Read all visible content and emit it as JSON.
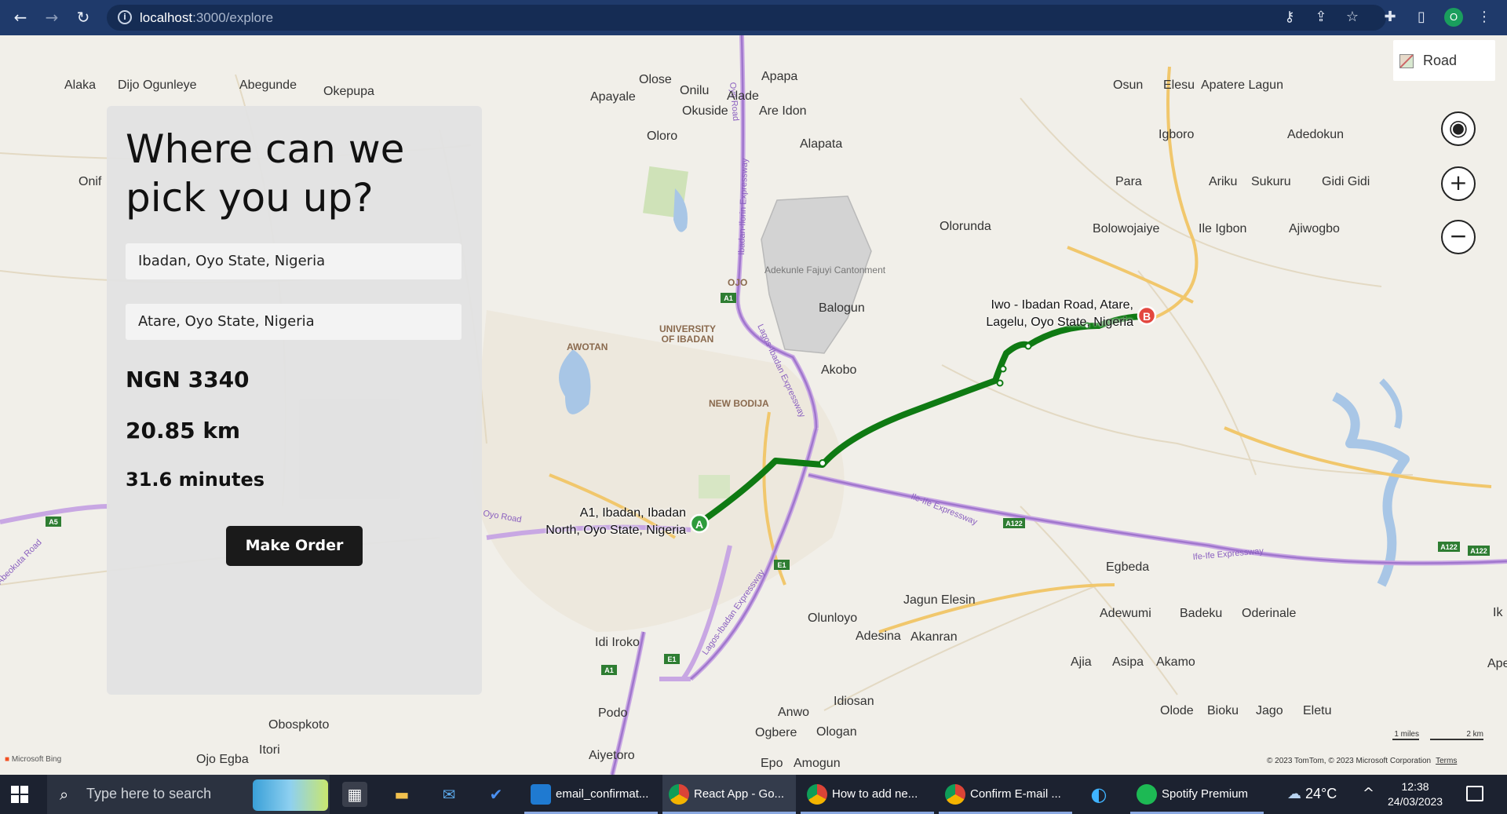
{
  "browser": {
    "url_host": "localhost",
    "url_path": ":3000/explore",
    "profile_initial": "O"
  },
  "map": {
    "type_label": "Road",
    "places": [
      {
        "name": "Alaka"
      },
      {
        "name": "Dijo Ogunleye"
      },
      {
        "name": "Abegunde"
      },
      {
        "name": "Okepupa"
      },
      {
        "name": "Olose"
      },
      {
        "name": "Onilu"
      },
      {
        "name": "Apapa"
      },
      {
        "name": "Apayale"
      },
      {
        "name": "Alade"
      },
      {
        "name": "Okuside"
      },
      {
        "name": "Are Idon"
      },
      {
        "name": "Oloro"
      },
      {
        "name": "Alapata"
      },
      {
        "name": "Osun"
      },
      {
        "name": "Elesu"
      },
      {
        "name": "Apatere Lagun"
      },
      {
        "name": "Igboro"
      },
      {
        "name": "Adedokun"
      },
      {
        "name": "Para"
      },
      {
        "name": "Ariku"
      },
      {
        "name": "Sukuru"
      },
      {
        "name": "Gidi Gidi"
      },
      {
        "name": "Olorunda"
      },
      {
        "name": "Bolowojaiye"
      },
      {
        "name": "Ile Igbon"
      },
      {
        "name": "Ajiwogbo"
      },
      {
        "name": "Balogun"
      },
      {
        "name": "Akobo"
      },
      {
        "name": "Onif"
      },
      {
        "name": "Egbeda"
      },
      {
        "name": "Adewumi"
      },
      {
        "name": "Badeku"
      },
      {
        "name": "Oderinale"
      },
      {
        "name": "Jagun Elesin"
      },
      {
        "name": "Olunloyo"
      },
      {
        "name": "Adesina"
      },
      {
        "name": "Akanran"
      },
      {
        "name": "Ajia"
      },
      {
        "name": "Asipa"
      },
      {
        "name": "Akamo"
      },
      {
        "name": "Idi Iroko"
      },
      {
        "name": "Podo"
      },
      {
        "name": "Anwo"
      },
      {
        "name": "Idiosan"
      },
      {
        "name": "Ogbere"
      },
      {
        "name": "Ologan"
      },
      {
        "name": "Obospkoto"
      },
      {
        "name": "Itori"
      },
      {
        "name": "Ojo Egba"
      },
      {
        "name": "Aiyetoro"
      },
      {
        "name": "Epo"
      },
      {
        "name": "Amogun"
      },
      {
        "name": "Olode"
      },
      {
        "name": "Bioku"
      },
      {
        "name": "Jago"
      },
      {
        "name": "Eletu"
      },
      {
        "name": "Ik"
      },
      {
        "name": "Ape"
      }
    ],
    "district_labels": [
      "Adekunle Fajuyi Cantonment",
      "UNIVERSITY OF IBADAN",
      "AWOTAN",
      "NEW BODIJA",
      "OJO"
    ],
    "road_labels": [
      "Oyo Road",
      "Ibadan-Ilorin Expressway",
      "Lagos-Ibadan Expressway",
      "Ile-Ife Expressway",
      "Ife-Ife Expressway",
      "Abeokuta Road",
      "Oyo Road"
    ],
    "road_shields": [
      "A1",
      "A1",
      "E1",
      "E1",
      "A122",
      "A122",
      "A122",
      "A5"
    ],
    "start_label_line1": "A1, Ibadan, Ibadan",
    "start_label_line2": "North, Oyo State, Nigeria",
    "end_label_line1": "Iwo - Ibadan Road, Atare,",
    "end_label_line2": "Lagelu, Oyo State, Nigeria",
    "start_marker": "A",
    "end_marker": "B",
    "scale_miles": "1 miles",
    "scale_km": "2 km",
    "bing": "Microsoft Bing",
    "copyright": "© 2023 TomTom, © 2023 Microsoft Corporation",
    "terms": "Terms"
  },
  "panel": {
    "title": "Where can we pick you up?",
    "pickup_value": "Ibadan, Oyo State, Nigeria",
    "destination_value": "Atare, Oyo State, Nigeria",
    "price": "NGN 3340",
    "distance": "20.85 km",
    "duration": "31.6 minutes",
    "order_button": "Make Order"
  },
  "taskbar": {
    "search_placeholder": "Type here to search",
    "apps": [
      {
        "label": "email_confirmat...",
        "icon": "vscode-icon"
      },
      {
        "label": "React App - Go...",
        "icon": "chrome-icon"
      },
      {
        "label": "How to add ne...",
        "icon": "chrome-icon"
      },
      {
        "label": "Confirm E-mail ...",
        "icon": "chrome-icon"
      },
      {
        "label": "Spotify Premium",
        "icon": "spotify-icon"
      }
    ],
    "temperature": "24°C",
    "time": "12:38",
    "date": "24/03/2023"
  },
  "colors": {
    "chrome_bar": "#1f3a6b",
    "route": "#0f7a13",
    "start_marker": "#2e9b3c",
    "end_marker": "#e3473f",
    "button": "#1a1a1a",
    "taskbar": "#1c2230"
  }
}
